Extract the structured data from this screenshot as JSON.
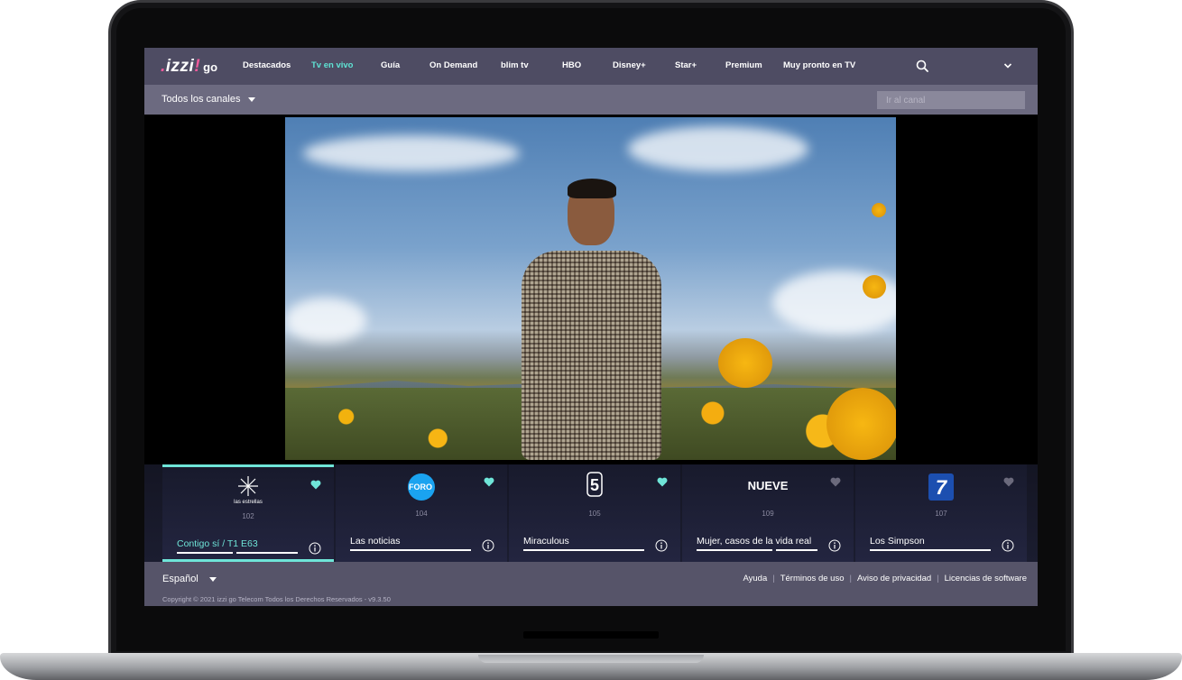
{
  "brand": {
    "logo_main": "izzi",
    "logo_suffix": "go"
  },
  "nav": {
    "items": [
      {
        "label": "Destacados",
        "active": false
      },
      {
        "label": "Tv en vivo",
        "active": true
      },
      {
        "label": "Guía",
        "active": false
      },
      {
        "label": "On Demand",
        "active": false
      },
      {
        "label": "blim tv",
        "active": false
      },
      {
        "label": "HBO",
        "active": false
      },
      {
        "label": "Disney+",
        "active": false
      },
      {
        "label": "Star+",
        "active": false
      },
      {
        "label": "Premium",
        "active": false
      },
      {
        "label": "Muy pronto en TV",
        "active": false
      }
    ],
    "search_icon": "search-icon",
    "menu_icon": "chevron-down-icon"
  },
  "subbar": {
    "channel_filter": "Todos los canales",
    "channel_search_placeholder": "Ir al canal"
  },
  "channels": [
    {
      "logo_text": "las estrellas",
      "number": "102",
      "program": "Contigo sí / T1 E63",
      "favorite": true,
      "selected": true,
      "progress": 0.5
    },
    {
      "logo_text": "FORO",
      "number": "104",
      "program": "Las noticias",
      "favorite": true,
      "selected": false,
      "progress": 0.97
    },
    {
      "logo_text": "5",
      "number": "105",
      "program": "Miraculous",
      "favorite": true,
      "selected": false,
      "progress": 0.97
    },
    {
      "logo_text": "NUEVE",
      "number": "109",
      "program": "Mujer, casos de la vida real",
      "favorite": false,
      "selected": false,
      "progress": 0.62
    },
    {
      "logo_text": "7",
      "number": "107",
      "program": "Los Simpson",
      "favorite": false,
      "selected": false,
      "progress": 0.97
    }
  ],
  "footer": {
    "language": "Español",
    "links": [
      "Ayuda",
      "Términos de uso",
      "Aviso de privacidad",
      "Licencias de software"
    ],
    "copyright": "Copyright © 2021 izzi go Telecom Todos los Derechos Reservados - v9.3.50"
  },
  "colors": {
    "accent": "#5fe3d4",
    "nav_bg": "#4e4c63",
    "subbar_bg": "#6c6a80",
    "footer_bg": "#565469",
    "favorite_on": "#6fe5d8",
    "favorite_off": "#6b6a7c"
  }
}
